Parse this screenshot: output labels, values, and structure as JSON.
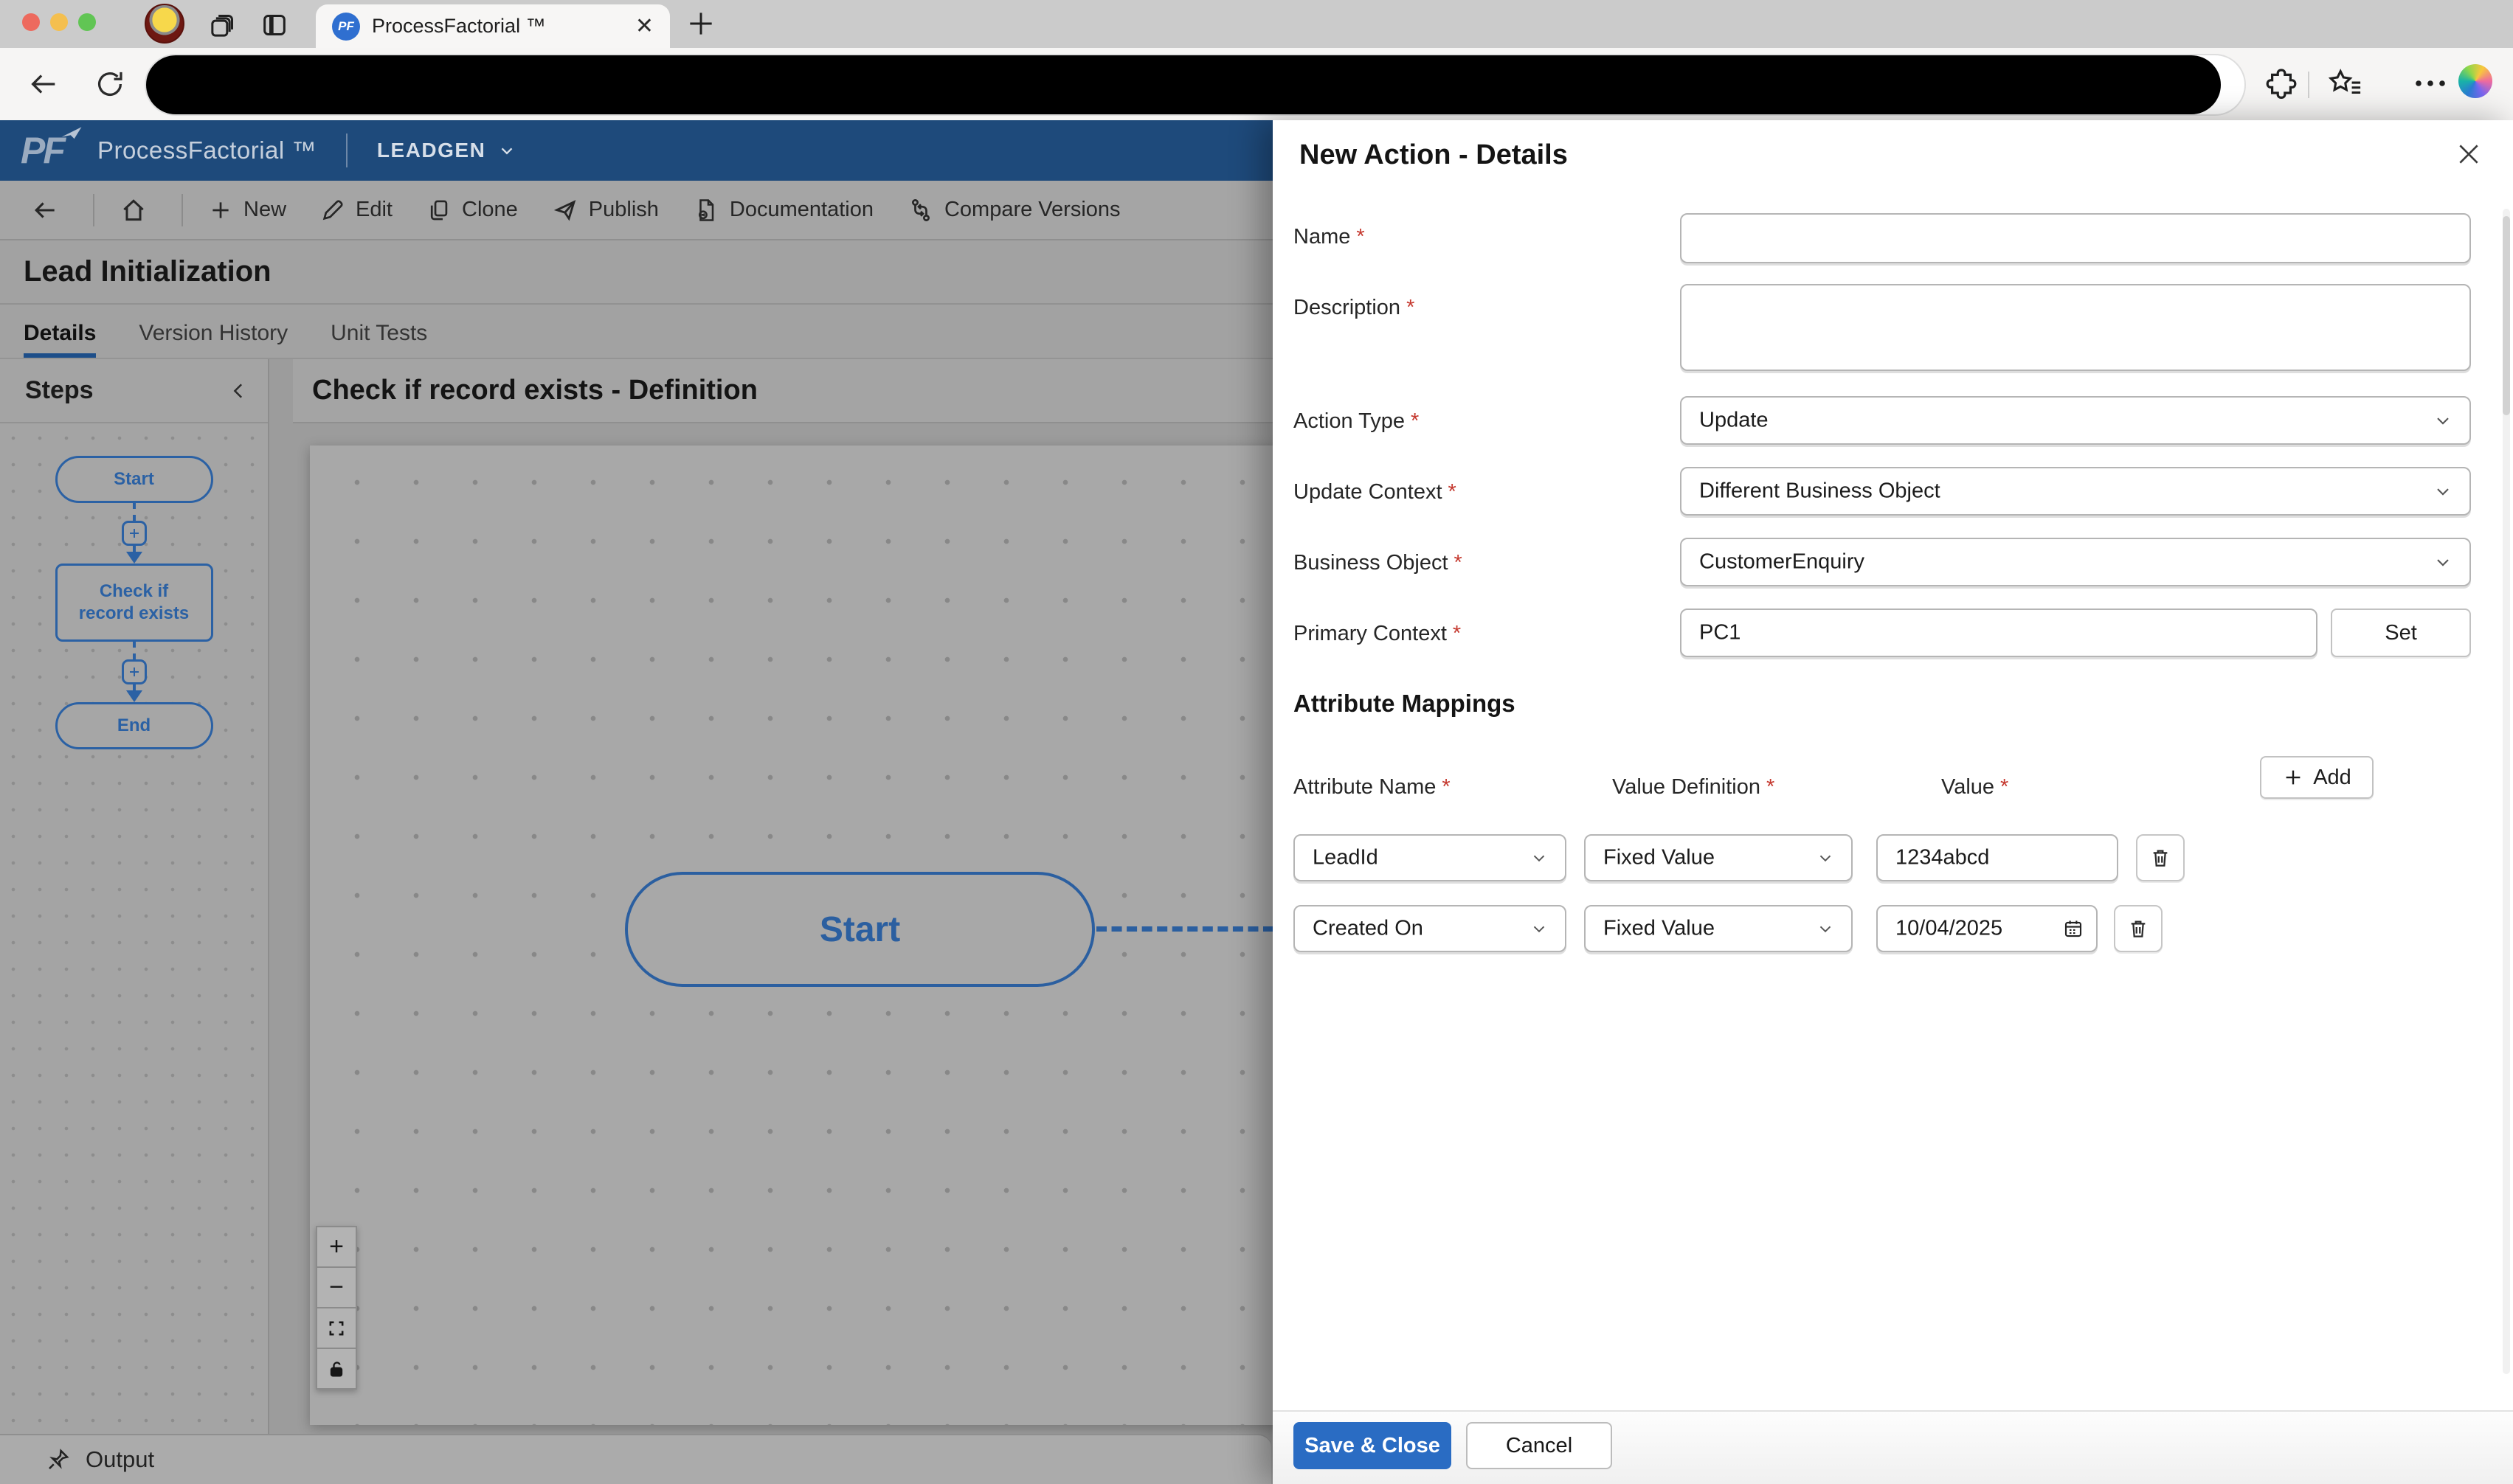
{
  "browser": {
    "tab_title": "ProcessFactorial ™",
    "close_tab_label": "✕"
  },
  "app_header": {
    "logo_monogram": "PF",
    "brand": "ProcessFactorial ™",
    "workspace": "LEADGEN"
  },
  "toolbar": {
    "items": [
      "New",
      "Edit",
      "Clone",
      "Publish",
      "Documentation",
      "Compare Versions"
    ]
  },
  "page": {
    "title": "Lead Initialization",
    "tabs": [
      "Details",
      "Version History",
      "Unit Tests"
    ],
    "active_tab": "Details"
  },
  "steps": {
    "title": "Steps",
    "nodes": [
      "Start",
      "Check if record exists",
      "End"
    ]
  },
  "canvas": {
    "title": "Check if record exists - Definition",
    "node_label": "Start",
    "zoom_in_label": "+",
    "zoom_out_label": "−"
  },
  "output_bar": {
    "label": "Output"
  },
  "panel": {
    "title": "New Action - Details",
    "required_marker": "*",
    "fields": {
      "name": {
        "label": "Name",
        "value": ""
      },
      "description": {
        "label": "Description",
        "value": ""
      },
      "action_type": {
        "label": "Action Type",
        "value": "Update"
      },
      "update_context": {
        "label": "Update Context",
        "value": "Different Business Object"
      },
      "business_object": {
        "label": "Business Object",
        "value": "CustomerEnquiry"
      },
      "primary_context": {
        "label": "Primary Context",
        "value": "PC1",
        "button": "Set"
      }
    },
    "mappings": {
      "title": "Attribute Mappings",
      "add_label": "Add",
      "headers": [
        "Attribute Name",
        "Value Definition",
        "Value"
      ],
      "rows": [
        {
          "attribute": "LeadId",
          "definition": "Fixed Value",
          "value": "1234abcd"
        },
        {
          "attribute": "Created On",
          "definition": "Fixed Value",
          "value": "10/04/2025"
        }
      ]
    },
    "footer": {
      "save": "Save & Close",
      "cancel": "Cancel"
    }
  },
  "colors": {
    "header_blue": "#1e4a7b",
    "accent_blue": "#2a6cc3",
    "node_blue": "#2b5fa0",
    "required_red": "#c5392f"
  }
}
